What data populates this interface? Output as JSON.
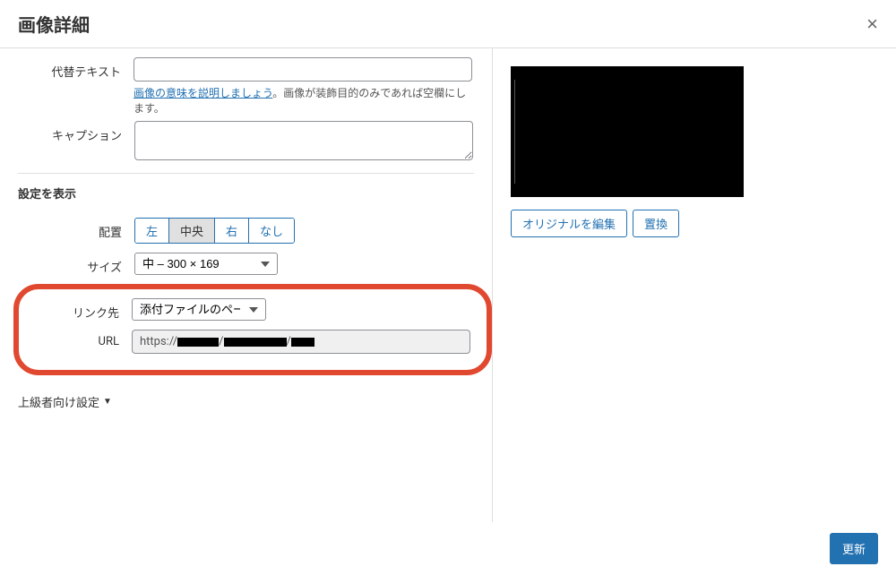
{
  "header": {
    "title": "画像詳細"
  },
  "fields": {
    "altText": {
      "label": "代替テキスト",
      "value": "",
      "hintLink": "画像の意味を説明しましょう",
      "hintRest": "。画像が装飾目的のみであれば空欄にします。"
    },
    "caption": {
      "label": "キャプション",
      "value": ""
    }
  },
  "display": {
    "sectionTitle": "設定を表示",
    "align": {
      "label": "配置",
      "left": "左",
      "center": "中央",
      "right": "右",
      "none": "なし",
      "selected": "center"
    },
    "size": {
      "label": "サイズ",
      "value": "中 – 300 × 169"
    },
    "linkTo": {
      "label": "リンク先",
      "value": "添付ファイルのページ"
    },
    "url": {
      "label": "URL",
      "prefix": "https://",
      "sep": "/"
    }
  },
  "advanced": {
    "label": "上級者向け設定"
  },
  "rightPane": {
    "editOriginal": "オリジナルを編集",
    "replace": "置換"
  },
  "footer": {
    "update": "更新"
  }
}
